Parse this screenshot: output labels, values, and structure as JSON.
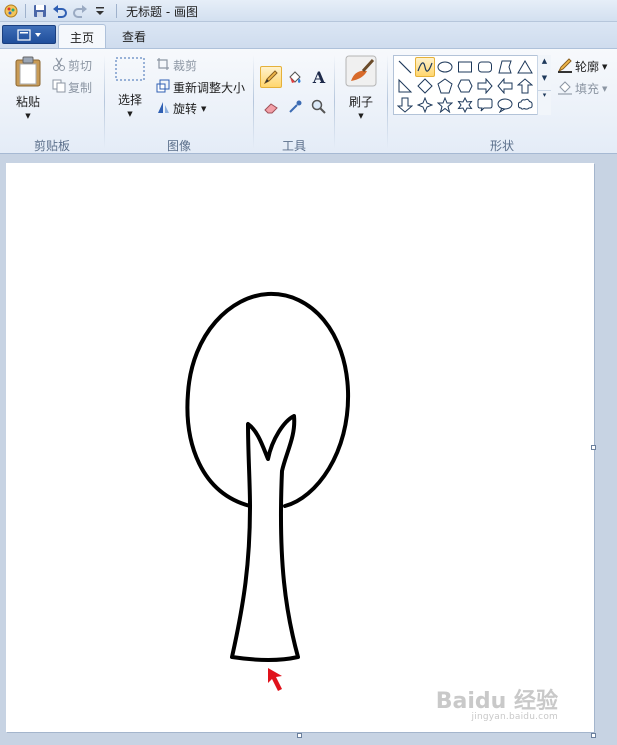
{
  "window": {
    "title": "无标题 - 画图"
  },
  "tabs": [
    {
      "label": "主页"
    },
    {
      "label": "查看"
    }
  ],
  "clipboard": {
    "paste": "粘贴",
    "cut": "剪切",
    "copy": "复制",
    "group": "剪贴板"
  },
  "image": {
    "select": "选择",
    "crop": "裁剪",
    "resize": "重新调整大小",
    "rotate": "旋转",
    "group": "图像"
  },
  "tools": {
    "group": "工具",
    "selected": "pencil"
  },
  "brushes": {
    "label": "刷子"
  },
  "shapes": {
    "group": "形状",
    "outline": "轮廓",
    "fill": "填充",
    "items": [
      "line",
      "curve",
      "oval",
      "rectangle",
      "rounded-rectangle",
      "polygon",
      "triangle",
      "right-triangle",
      "diamond",
      "pentagon",
      "hexagon",
      "right-arrow",
      "left-arrow",
      "up-arrow",
      "down-arrow",
      "four-point-star",
      "five-point-star",
      "six-point-star",
      "rounded-callout",
      "oval-callout",
      "cloud-callout"
    ],
    "selected": "curve"
  },
  "canvas": {
    "drawing": "tree outline with oval crown and forked trunk",
    "pointer_color": "#e0121b"
  },
  "watermark": {
    "brand": "Baidu 经验",
    "url": "jingyan.baidu.com"
  },
  "colors": {
    "accent": "#1f4e9b",
    "highlight": "#ffd66e",
    "ribbon_bg": "#eef3fa",
    "workspace": "#c7d3e3"
  }
}
